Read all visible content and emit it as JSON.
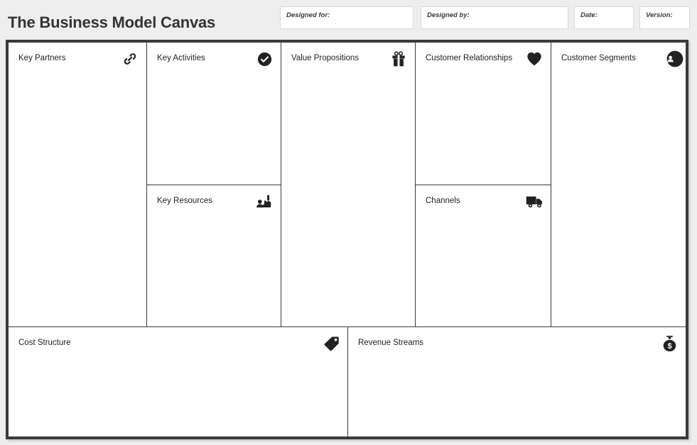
{
  "header": {
    "title": "The Business Model Canvas",
    "fields": [
      {
        "key": "designed_for",
        "label": "Designed for:",
        "value": ""
      },
      {
        "key": "designed_by",
        "label": "Designed by:",
        "value": ""
      },
      {
        "key": "date",
        "label": "Date:",
        "value": ""
      },
      {
        "key": "version",
        "label": "Version:",
        "value": ""
      }
    ]
  },
  "canvas": {
    "blocks": [
      {
        "key": "key_partners",
        "title": "Key Partners",
        "icon": "link-icon",
        "content": ""
      },
      {
        "key": "key_activities",
        "title": "Key Activities",
        "icon": "check-circle-icon",
        "content": ""
      },
      {
        "key": "key_resources",
        "title": "Key Resources",
        "icon": "factory-icon",
        "content": ""
      },
      {
        "key": "value_propositions",
        "title": "Value Propositions",
        "icon": "gift-icon",
        "content": ""
      },
      {
        "key": "customer_relationships",
        "title": "Customer Relationships",
        "icon": "heart-icon",
        "content": ""
      },
      {
        "key": "channels",
        "title": "Channels",
        "icon": "truck-icon",
        "content": ""
      },
      {
        "key": "customer_segments",
        "title": "Customer Segments",
        "icon": "users-icon",
        "content": ""
      },
      {
        "key": "cost_structure",
        "title": "Cost Structure",
        "icon": "price-tag-icon",
        "content": ""
      },
      {
        "key": "revenue_streams",
        "title": "Revenue Streams",
        "icon": "money-bag-icon",
        "content": ""
      }
    ]
  },
  "colors": {
    "page_background": "#eeeeee",
    "canvas_background": "#ffffff",
    "border": "#3a3a3a",
    "title_text": "#333333",
    "block_text": "#222222",
    "icon": "#222222",
    "field_border": "#d8d8d8"
  }
}
